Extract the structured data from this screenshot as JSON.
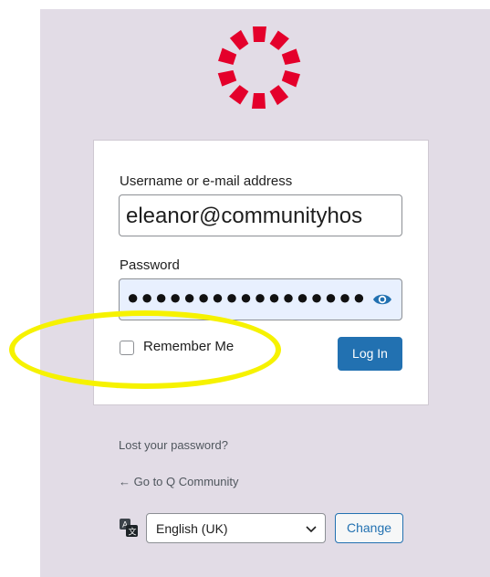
{
  "logo": {
    "icon": "q-community-logo-icon",
    "color": "#e4002b"
  },
  "form": {
    "username_label": "Username or e-mail address",
    "username_value": "eleanor@communityhos",
    "password_label": "Password",
    "password_mask": "●●●●●●●●●●●●●●●●●",
    "show_password_icon": "eye-icon",
    "remember_label": "Remember Me",
    "remember_checked": false,
    "login_label": "Log In"
  },
  "links": {
    "lost_password": "Lost your password?",
    "back_to_site": "← Go to Q Community"
  },
  "language": {
    "icon": "translate-icon",
    "selected": "English (UK)",
    "change_label": "Change"
  },
  "annotation": {
    "color": "#f6f200",
    "type": "highlight-ellipse"
  }
}
